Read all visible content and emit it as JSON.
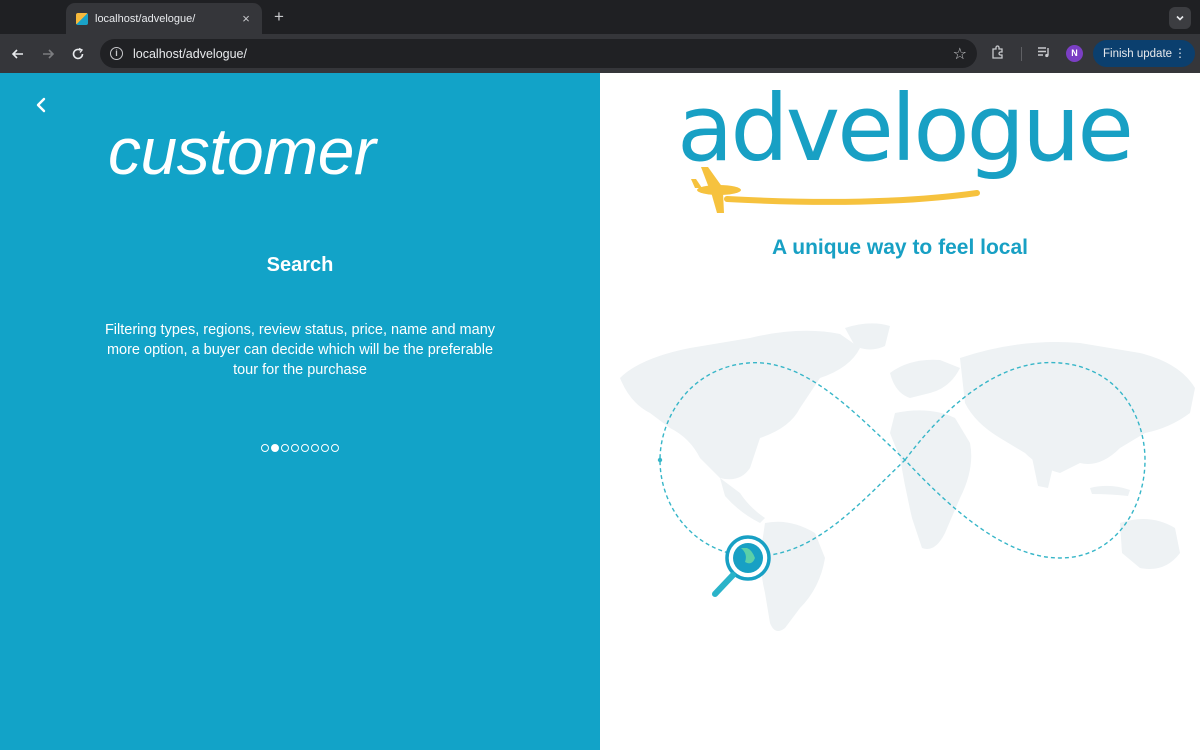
{
  "browser": {
    "tab_title": "localhost/advelogue/",
    "tab_close": "×",
    "new_tab": "+",
    "url": "localhost/advelogue/",
    "profile_initial": "N",
    "update_label": "Finish update",
    "icons": [
      "favicon-icon",
      "close-icon",
      "plus-icon",
      "chevron-down-icon",
      "back-arrow-icon",
      "forward-arrow-icon",
      "reload-icon",
      "info-icon",
      "star-icon",
      "extensions-icon",
      "media-controls-icon",
      "more-vert-icon"
    ]
  },
  "onboarding": {
    "section_title": "customer",
    "feature_title": "Search",
    "feature_description": "Filtering types, regions, review status, price, name and many more option, a buyer can decide which will be the preferable tour for the purchase",
    "slide_count": 8,
    "active_slide_index": 1,
    "panel_color": "#12a3c8"
  },
  "brand": {
    "logo_text": "advelogue",
    "tagline": "A unique way to feel local",
    "primary_color": "#18a0c4",
    "accent_color": "#f6c23e"
  }
}
